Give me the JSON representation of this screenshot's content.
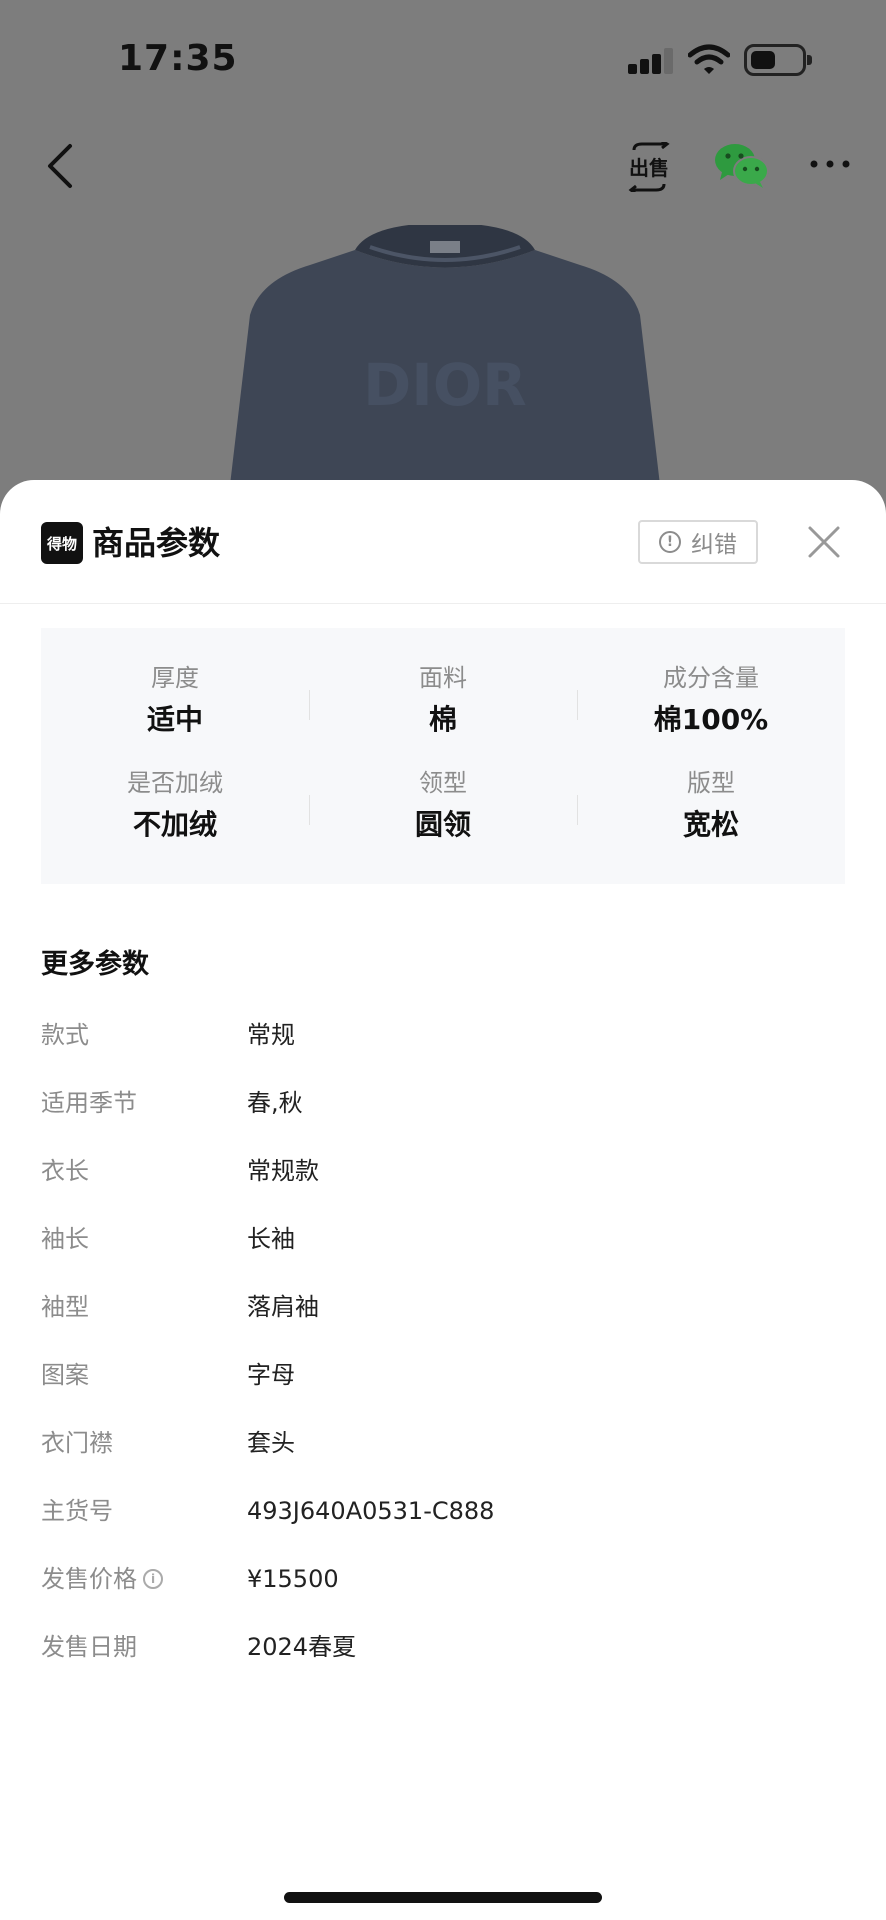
{
  "status_bar": {
    "time": "17:35"
  },
  "nav": {
    "back_icon": "chevron-left-icon",
    "sell_label": "出售",
    "wechat_icon": "wechat-icon",
    "more_icon": "more-dots-icon"
  },
  "product": {
    "print_text": "DIOR"
  },
  "sheet": {
    "logo_text": "得物",
    "title": "商品参数",
    "correct_label": "纠错",
    "close_icon": "close-icon"
  },
  "specs": [
    {
      "label": "厚度",
      "value": "适中"
    },
    {
      "label": "面料",
      "value": "棉"
    },
    {
      "label": "成分含量",
      "value": "棉100%"
    },
    {
      "label": "是否加绒",
      "value": "不加绒"
    },
    {
      "label": "领型",
      "value": "圆领"
    },
    {
      "label": "版型",
      "value": "宽松"
    }
  ],
  "more": {
    "title": "更多参数",
    "rows": [
      {
        "key": "款式",
        "value": "常规"
      },
      {
        "key": "适用季节",
        "value": "春,秋"
      },
      {
        "key": "衣长",
        "value": "常规款"
      },
      {
        "key": "袖长",
        "value": "长袖"
      },
      {
        "key": "袖型",
        "value": "落肩袖"
      },
      {
        "key": "图案",
        "value": "字母"
      },
      {
        "key": "衣门襟",
        "value": "套头"
      },
      {
        "key": "主货号",
        "value": "493J640A0531-C888"
      },
      {
        "key": "发售价格",
        "value": "¥15500"
      },
      {
        "key": "发售日期",
        "value": "2024春夏"
      }
    ]
  },
  "colors": {
    "overlay": "#7d7d7d",
    "sheet_bg": "#ffffff",
    "spec_bg": "#f7f8fa",
    "muted_text": "#8c8c8c",
    "primary_text": "#111111",
    "wechat_green": "#2e9a3f"
  }
}
